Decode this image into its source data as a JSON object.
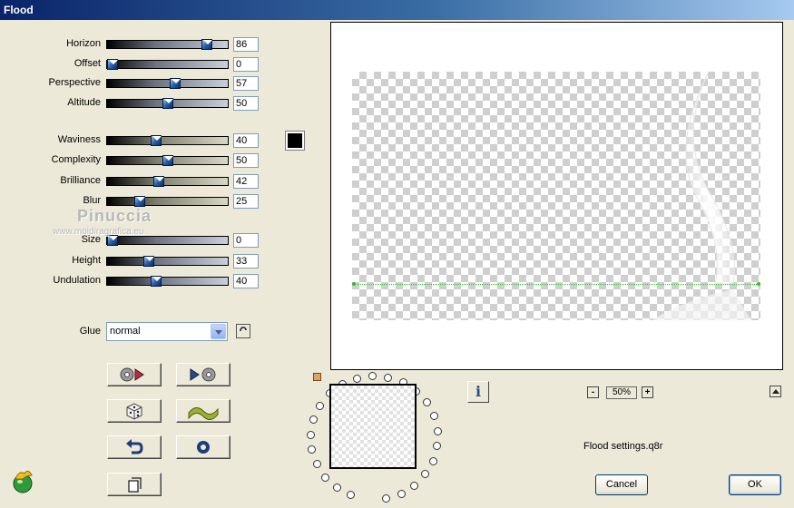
{
  "window": {
    "title": "Flood"
  },
  "sliders": [
    {
      "id": "horizon",
      "label": "Horizon",
      "value": "86",
      "fraction": 0.86,
      "style": "blue"
    },
    {
      "id": "offset",
      "label": "Offset",
      "value": "0",
      "fraction": 0.0,
      "style": "blue"
    },
    {
      "id": "perspective",
      "label": "Perspective",
      "value": "57",
      "fraction": 0.57,
      "style": "blue"
    },
    {
      "id": "altitude",
      "label": "Altitude",
      "value": "50",
      "fraction": 0.5,
      "style": "blue"
    },
    {
      "id": "waviness",
      "label": "Waviness",
      "value": "40",
      "fraction": 0.4,
      "style": "olive"
    },
    {
      "id": "complexity",
      "label": "Complexity",
      "value": "50",
      "fraction": 0.5,
      "style": "olive"
    },
    {
      "id": "brilliance",
      "label": "Brilliance",
      "value": "42",
      "fraction": 0.42,
      "style": "olive"
    },
    {
      "id": "blur",
      "label": "Blur",
      "value": "25",
      "fraction": 0.25,
      "style": "olive"
    },
    {
      "id": "size",
      "label": "Size",
      "value": "0",
      "fraction": 0.0,
      "style": "blue"
    },
    {
      "id": "height",
      "label": "Height",
      "value": "33",
      "fraction": 0.33,
      "style": "blue"
    },
    {
      "id": "undulation",
      "label": "Undulation",
      "value": "40",
      "fraction": 0.4,
      "style": "blue"
    }
  ],
  "color_swatch": {
    "color": "#000000"
  },
  "watermark": {
    "name": "Pinuccia",
    "url": "www.moidiragrafica.eu"
  },
  "glue": {
    "label": "Glue",
    "selected": "normal"
  },
  "tool_buttons": [
    {
      "id": "prev-preset",
      "icon": "rewind-preset-icon"
    },
    {
      "id": "next-preset",
      "icon": "forward-preset-icon"
    },
    {
      "id": "randomize",
      "icon": "dice-icon"
    },
    {
      "id": "wave",
      "icon": "wave-icon"
    },
    {
      "id": "reset",
      "icon": "undo-icon"
    },
    {
      "id": "options",
      "icon": "ring-icon"
    },
    {
      "id": "copy",
      "icon": "copy-icon"
    }
  ],
  "preview": {
    "zoom": "50%",
    "zoom_out": "-",
    "zoom_in": "+"
  },
  "info_button": {
    "glyph": "i"
  },
  "settings_file": "Flood settings.q8r",
  "buttons": {
    "cancel": "Cancel",
    "ok": "OK"
  }
}
